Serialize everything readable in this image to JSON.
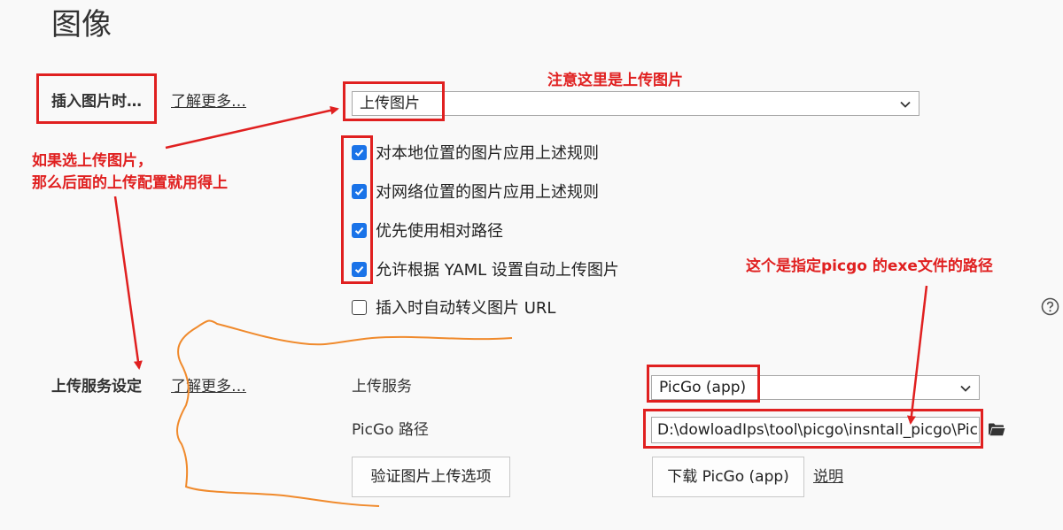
{
  "page": {
    "title": "图像"
  },
  "insert_section": {
    "label": "插入图片时…",
    "learn_more": "了解更多…",
    "select_value": "上传图片",
    "checkboxes": [
      {
        "label": "对本地位置的图片应用上述规则",
        "checked": true
      },
      {
        "label": "对网络位置的图片应用上述规则",
        "checked": true
      },
      {
        "label": "优先使用相对路径",
        "checked": true
      },
      {
        "label": "允许根据 YAML 设置自动上传图片",
        "checked": true
      },
      {
        "label": "插入时自动转义图片 URL",
        "checked": false
      }
    ]
  },
  "upload_section": {
    "label": "上传服务设定",
    "learn_more": "了解更多…",
    "service_label": "上传服务",
    "service_value": "PicGo (app)",
    "path_label": "PicGo 路径",
    "path_value": "D:\\dowloadIps\\tool\\picgo\\insntall_picgo\\PicGo.exe",
    "verify_button": "验证图片上传选项",
    "download_button": "下载 PicGo (app)",
    "help_link": "说明"
  },
  "annotations": {
    "note_upload": "注意这里是上传图片",
    "note_select_line1": "如果选上传图片，",
    "note_select_line2": "那么后面的上传配置就用得上",
    "note_path": "这个是指定picgo 的exe文件的路径"
  },
  "icons": {
    "help": "help-circle-icon",
    "folder": "folder-icon",
    "chevron": "chevron-down-icon",
    "check": "checkmark-icon"
  },
  "colors": {
    "accent": "#1a73e8",
    "annotation_red": "#e02020",
    "scribble_orange": "#f08a2c",
    "background": "#f9f9f9"
  }
}
